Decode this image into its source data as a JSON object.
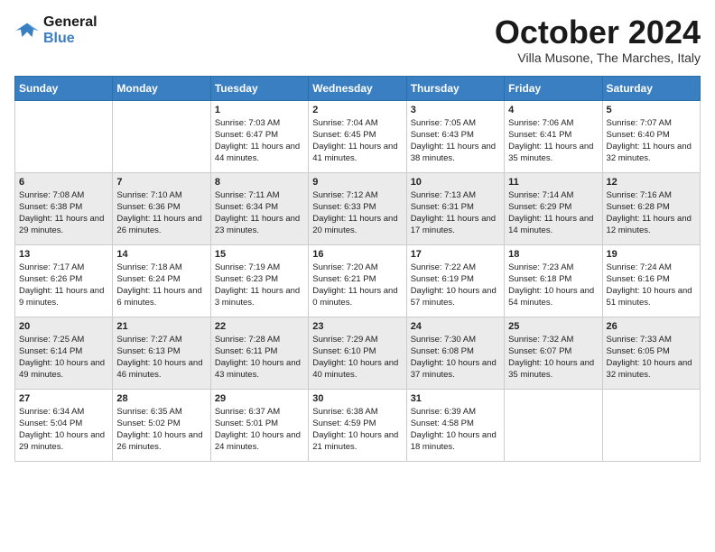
{
  "header": {
    "logo_general": "General",
    "logo_blue": "Blue",
    "month_title": "October 2024",
    "location": "Villa Musone, The Marches, Italy"
  },
  "days_of_week": [
    "Sunday",
    "Monday",
    "Tuesday",
    "Wednesday",
    "Thursday",
    "Friday",
    "Saturday"
  ],
  "weeks": [
    [
      {
        "num": "",
        "sunrise": "",
        "sunset": "",
        "daylight": ""
      },
      {
        "num": "",
        "sunrise": "",
        "sunset": "",
        "daylight": ""
      },
      {
        "num": "1",
        "sunrise": "Sunrise: 7:03 AM",
        "sunset": "Sunset: 6:47 PM",
        "daylight": "Daylight: 11 hours and 44 minutes."
      },
      {
        "num": "2",
        "sunrise": "Sunrise: 7:04 AM",
        "sunset": "Sunset: 6:45 PM",
        "daylight": "Daylight: 11 hours and 41 minutes."
      },
      {
        "num": "3",
        "sunrise": "Sunrise: 7:05 AM",
        "sunset": "Sunset: 6:43 PM",
        "daylight": "Daylight: 11 hours and 38 minutes."
      },
      {
        "num": "4",
        "sunrise": "Sunrise: 7:06 AM",
        "sunset": "Sunset: 6:41 PM",
        "daylight": "Daylight: 11 hours and 35 minutes."
      },
      {
        "num": "5",
        "sunrise": "Sunrise: 7:07 AM",
        "sunset": "Sunset: 6:40 PM",
        "daylight": "Daylight: 11 hours and 32 minutes."
      }
    ],
    [
      {
        "num": "6",
        "sunrise": "Sunrise: 7:08 AM",
        "sunset": "Sunset: 6:38 PM",
        "daylight": "Daylight: 11 hours and 29 minutes."
      },
      {
        "num": "7",
        "sunrise": "Sunrise: 7:10 AM",
        "sunset": "Sunset: 6:36 PM",
        "daylight": "Daylight: 11 hours and 26 minutes."
      },
      {
        "num": "8",
        "sunrise": "Sunrise: 7:11 AM",
        "sunset": "Sunset: 6:34 PM",
        "daylight": "Daylight: 11 hours and 23 minutes."
      },
      {
        "num": "9",
        "sunrise": "Sunrise: 7:12 AM",
        "sunset": "Sunset: 6:33 PM",
        "daylight": "Daylight: 11 hours and 20 minutes."
      },
      {
        "num": "10",
        "sunrise": "Sunrise: 7:13 AM",
        "sunset": "Sunset: 6:31 PM",
        "daylight": "Daylight: 11 hours and 17 minutes."
      },
      {
        "num": "11",
        "sunrise": "Sunrise: 7:14 AM",
        "sunset": "Sunset: 6:29 PM",
        "daylight": "Daylight: 11 hours and 14 minutes."
      },
      {
        "num": "12",
        "sunrise": "Sunrise: 7:16 AM",
        "sunset": "Sunset: 6:28 PM",
        "daylight": "Daylight: 11 hours and 12 minutes."
      }
    ],
    [
      {
        "num": "13",
        "sunrise": "Sunrise: 7:17 AM",
        "sunset": "Sunset: 6:26 PM",
        "daylight": "Daylight: 11 hours and 9 minutes."
      },
      {
        "num": "14",
        "sunrise": "Sunrise: 7:18 AM",
        "sunset": "Sunset: 6:24 PM",
        "daylight": "Daylight: 11 hours and 6 minutes."
      },
      {
        "num": "15",
        "sunrise": "Sunrise: 7:19 AM",
        "sunset": "Sunset: 6:23 PM",
        "daylight": "Daylight: 11 hours and 3 minutes."
      },
      {
        "num": "16",
        "sunrise": "Sunrise: 7:20 AM",
        "sunset": "Sunset: 6:21 PM",
        "daylight": "Daylight: 11 hours and 0 minutes."
      },
      {
        "num": "17",
        "sunrise": "Sunrise: 7:22 AM",
        "sunset": "Sunset: 6:19 PM",
        "daylight": "Daylight: 10 hours and 57 minutes."
      },
      {
        "num": "18",
        "sunrise": "Sunrise: 7:23 AM",
        "sunset": "Sunset: 6:18 PM",
        "daylight": "Daylight: 10 hours and 54 minutes."
      },
      {
        "num": "19",
        "sunrise": "Sunrise: 7:24 AM",
        "sunset": "Sunset: 6:16 PM",
        "daylight": "Daylight: 10 hours and 51 minutes."
      }
    ],
    [
      {
        "num": "20",
        "sunrise": "Sunrise: 7:25 AM",
        "sunset": "Sunset: 6:14 PM",
        "daylight": "Daylight: 10 hours and 49 minutes."
      },
      {
        "num": "21",
        "sunrise": "Sunrise: 7:27 AM",
        "sunset": "Sunset: 6:13 PM",
        "daylight": "Daylight: 10 hours and 46 minutes."
      },
      {
        "num": "22",
        "sunrise": "Sunrise: 7:28 AM",
        "sunset": "Sunset: 6:11 PM",
        "daylight": "Daylight: 10 hours and 43 minutes."
      },
      {
        "num": "23",
        "sunrise": "Sunrise: 7:29 AM",
        "sunset": "Sunset: 6:10 PM",
        "daylight": "Daylight: 10 hours and 40 minutes."
      },
      {
        "num": "24",
        "sunrise": "Sunrise: 7:30 AM",
        "sunset": "Sunset: 6:08 PM",
        "daylight": "Daylight: 10 hours and 37 minutes."
      },
      {
        "num": "25",
        "sunrise": "Sunrise: 7:32 AM",
        "sunset": "Sunset: 6:07 PM",
        "daylight": "Daylight: 10 hours and 35 minutes."
      },
      {
        "num": "26",
        "sunrise": "Sunrise: 7:33 AM",
        "sunset": "Sunset: 6:05 PM",
        "daylight": "Daylight: 10 hours and 32 minutes."
      }
    ],
    [
      {
        "num": "27",
        "sunrise": "Sunrise: 6:34 AM",
        "sunset": "Sunset: 5:04 PM",
        "daylight": "Daylight: 10 hours and 29 minutes."
      },
      {
        "num": "28",
        "sunrise": "Sunrise: 6:35 AM",
        "sunset": "Sunset: 5:02 PM",
        "daylight": "Daylight: 10 hours and 26 minutes."
      },
      {
        "num": "29",
        "sunrise": "Sunrise: 6:37 AM",
        "sunset": "Sunset: 5:01 PM",
        "daylight": "Daylight: 10 hours and 24 minutes."
      },
      {
        "num": "30",
        "sunrise": "Sunrise: 6:38 AM",
        "sunset": "Sunset: 4:59 PM",
        "daylight": "Daylight: 10 hours and 21 minutes."
      },
      {
        "num": "31",
        "sunrise": "Sunrise: 6:39 AM",
        "sunset": "Sunset: 4:58 PM",
        "daylight": "Daylight: 10 hours and 18 minutes."
      },
      {
        "num": "",
        "sunrise": "",
        "sunset": "",
        "daylight": ""
      },
      {
        "num": "",
        "sunrise": "",
        "sunset": "",
        "daylight": ""
      }
    ]
  ]
}
